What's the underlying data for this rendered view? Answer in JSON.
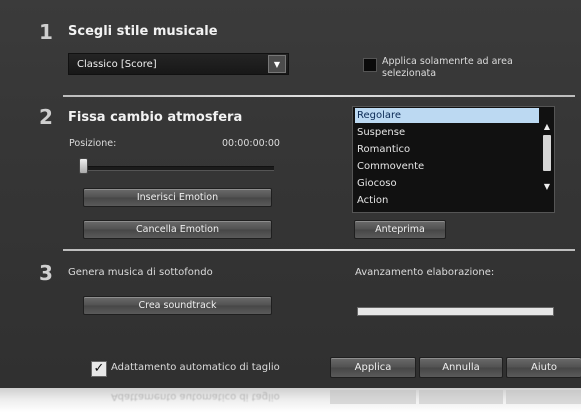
{
  "sections": [
    {
      "number": "1",
      "title": "Scegli stile musicale"
    },
    {
      "number": "2",
      "title": "Fissa cambio atmosfera"
    },
    {
      "number": "3",
      "title": "Genera musica di sottofondo"
    }
  ],
  "style": {
    "selected": "Classico [Score]",
    "apply_area_label": "Applica solamenrte ad area selezionata",
    "apply_area_checked": false
  },
  "emotion": {
    "position_label": "Posizione:",
    "position_value": "00:00:00:00",
    "slider_fraction": 0.0,
    "insert_label": "Inserisci Emotion",
    "delete_label": "Cancella Emotion",
    "moods": [
      "Regolare",
      "Suspense",
      "Romantico",
      "Commovente",
      "Giocoso",
      "Action"
    ],
    "selected_mood_index": 0,
    "preview_label": "Anteprima"
  },
  "generate": {
    "create_label": "Crea soundtrack",
    "progress_label": "Avanzamento elaborazione:",
    "progress_fraction": 1.0
  },
  "footer": {
    "auto_trim_label": "Adattamento automatico di taglio",
    "auto_trim_checked": true,
    "apply_label": "Applica",
    "cancel_label": "Annulla",
    "help_label": "Aiuto"
  },
  "colors": {
    "panel_bg": "#363636",
    "selection_bg": "#bcd9f2",
    "selection_text": "#0b2a55"
  }
}
